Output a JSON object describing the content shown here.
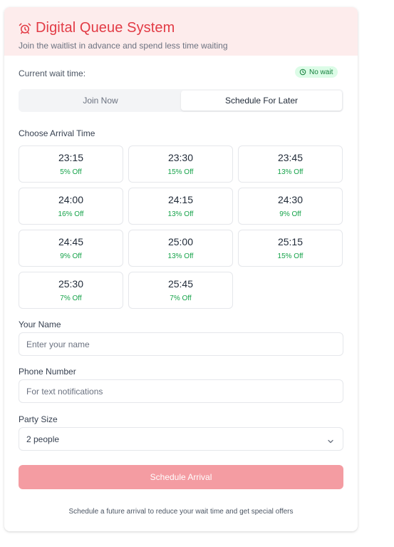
{
  "header": {
    "title": "Digital Queue System",
    "subtitle": "Join the waitlist in advance and spend less time waiting",
    "icon": "alarm-clock-icon",
    "accent_color": "#e23b45"
  },
  "wait": {
    "label": "Current wait time:",
    "badge": "No wait",
    "badge_icon": "clock-icon",
    "badge_color": "#15803d"
  },
  "tabs": [
    {
      "label": "Join Now",
      "active": false
    },
    {
      "label": "Schedule For Later",
      "active": true
    }
  ],
  "arrival": {
    "label": "Choose Arrival Time",
    "slots": [
      {
        "time": "23:15",
        "discount": "5% Off"
      },
      {
        "time": "23:30",
        "discount": "15% Off"
      },
      {
        "time": "23:45",
        "discount": "13% Off"
      },
      {
        "time": "24:00",
        "discount": "16% Off"
      },
      {
        "time": "24:15",
        "discount": "13% Off"
      },
      {
        "time": "24:30",
        "discount": "9% Off"
      },
      {
        "time": "24:45",
        "discount": "9% Off"
      },
      {
        "time": "25:00",
        "discount": "13% Off"
      },
      {
        "time": "25:15",
        "discount": "15% Off"
      },
      {
        "time": "25:30",
        "discount": "7% Off"
      },
      {
        "time": "25:45",
        "discount": "7% Off"
      }
    ]
  },
  "form": {
    "name_label": "Your Name",
    "name_placeholder": "Enter your name",
    "phone_label": "Phone Number",
    "phone_placeholder": "For text notifications",
    "party_label": "Party Size",
    "party_value": "2 people",
    "submit_label": "Schedule Arrival",
    "submit_color": "#f49ca2"
  },
  "footnote": "Schedule a future arrival to reduce your wait time and get special offers"
}
